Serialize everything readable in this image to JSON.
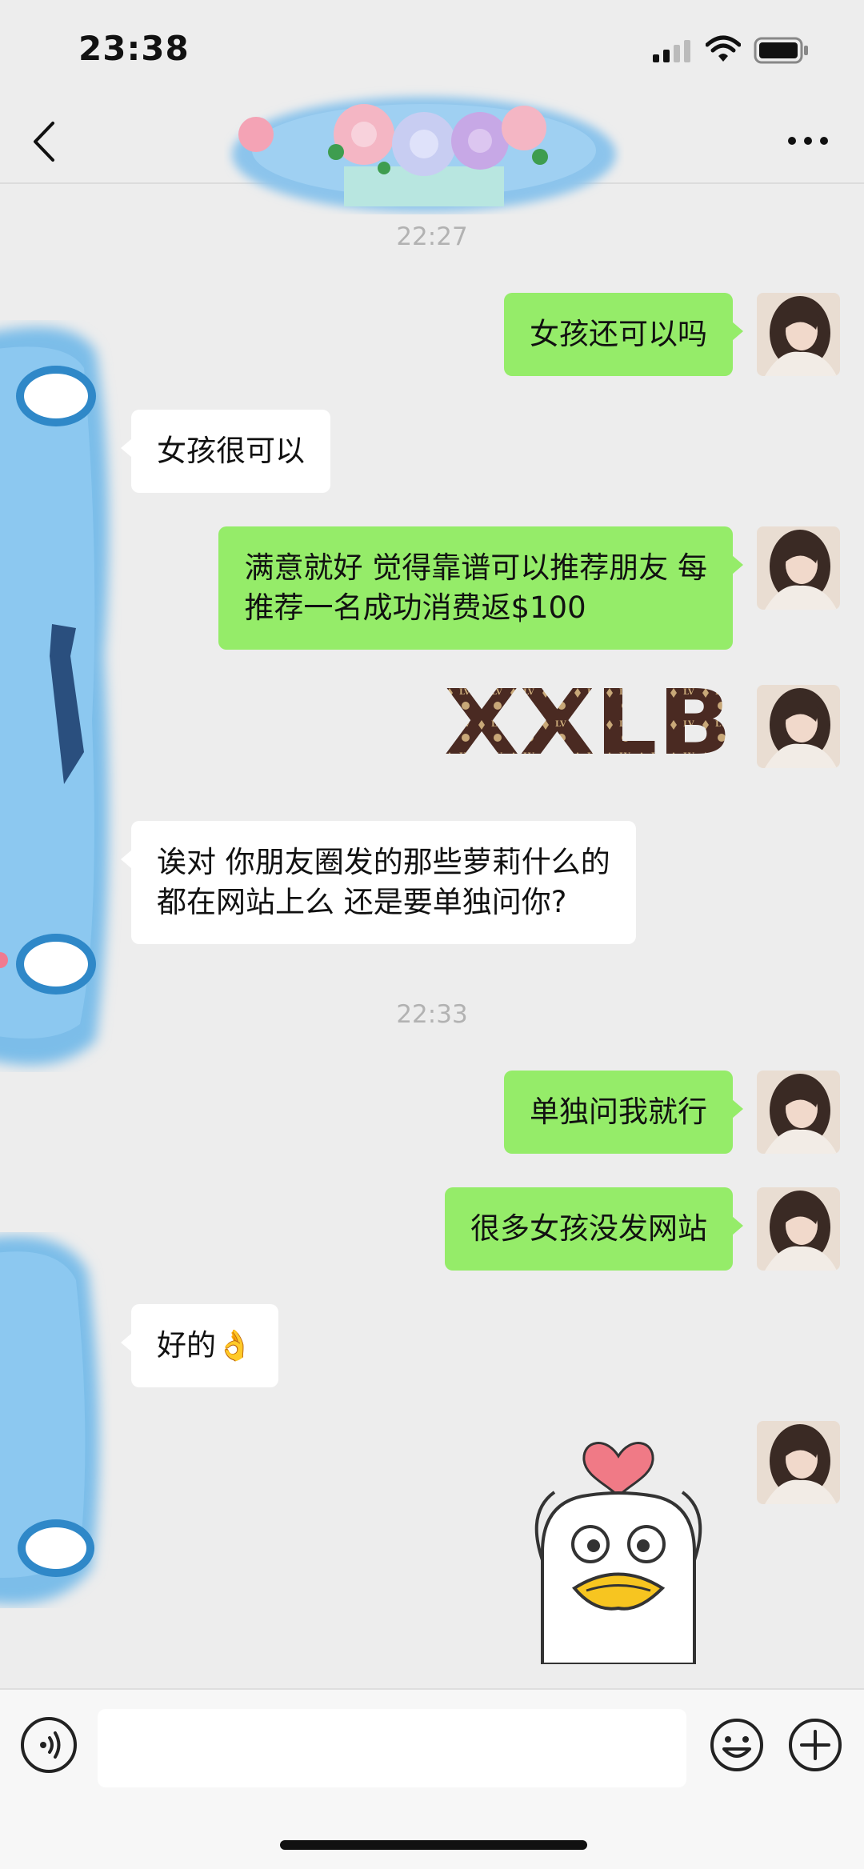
{
  "status_bar": {
    "time": "23:38"
  },
  "header": {
    "title": ""
  },
  "timestamps": [
    "22:27",
    "22:33"
  ],
  "messages": [
    {
      "side": "out",
      "lines": [
        "女孩还可以吗"
      ]
    },
    {
      "side": "in",
      "lines": [
        "女孩很可以"
      ]
    },
    {
      "side": "out",
      "lines": [
        "满意就好 觉得靠谱可以推荐朋友 每",
        "推荐一名成功消费返$100"
      ]
    },
    {
      "side": "out",
      "sticker": "XXLB"
    },
    {
      "side": "in",
      "lines": [
        "诶对 你朋友圈发的那些萝莉什么的",
        "都在网站上么 还是要单独问你?"
      ]
    },
    {
      "side": "out",
      "lines": [
        "单独问我就行"
      ]
    },
    {
      "side": "out",
      "lines": [
        "很多女孩没发网站"
      ]
    },
    {
      "side": "in",
      "lines": [
        "好的👌"
      ]
    },
    {
      "side": "out",
      "sticker": "duck-heart"
    }
  ],
  "input": {
    "placeholder": "",
    "value": ""
  },
  "colors": {
    "outgoing_bubble": "#95ec69",
    "incoming_bubble": "#ffffff",
    "background": "#ededed"
  },
  "icons": [
    "signal-icon",
    "wifi-icon",
    "battery-icon",
    "back-icon",
    "more-icon",
    "voice-icon",
    "emoji-icon",
    "plus-icon"
  ]
}
